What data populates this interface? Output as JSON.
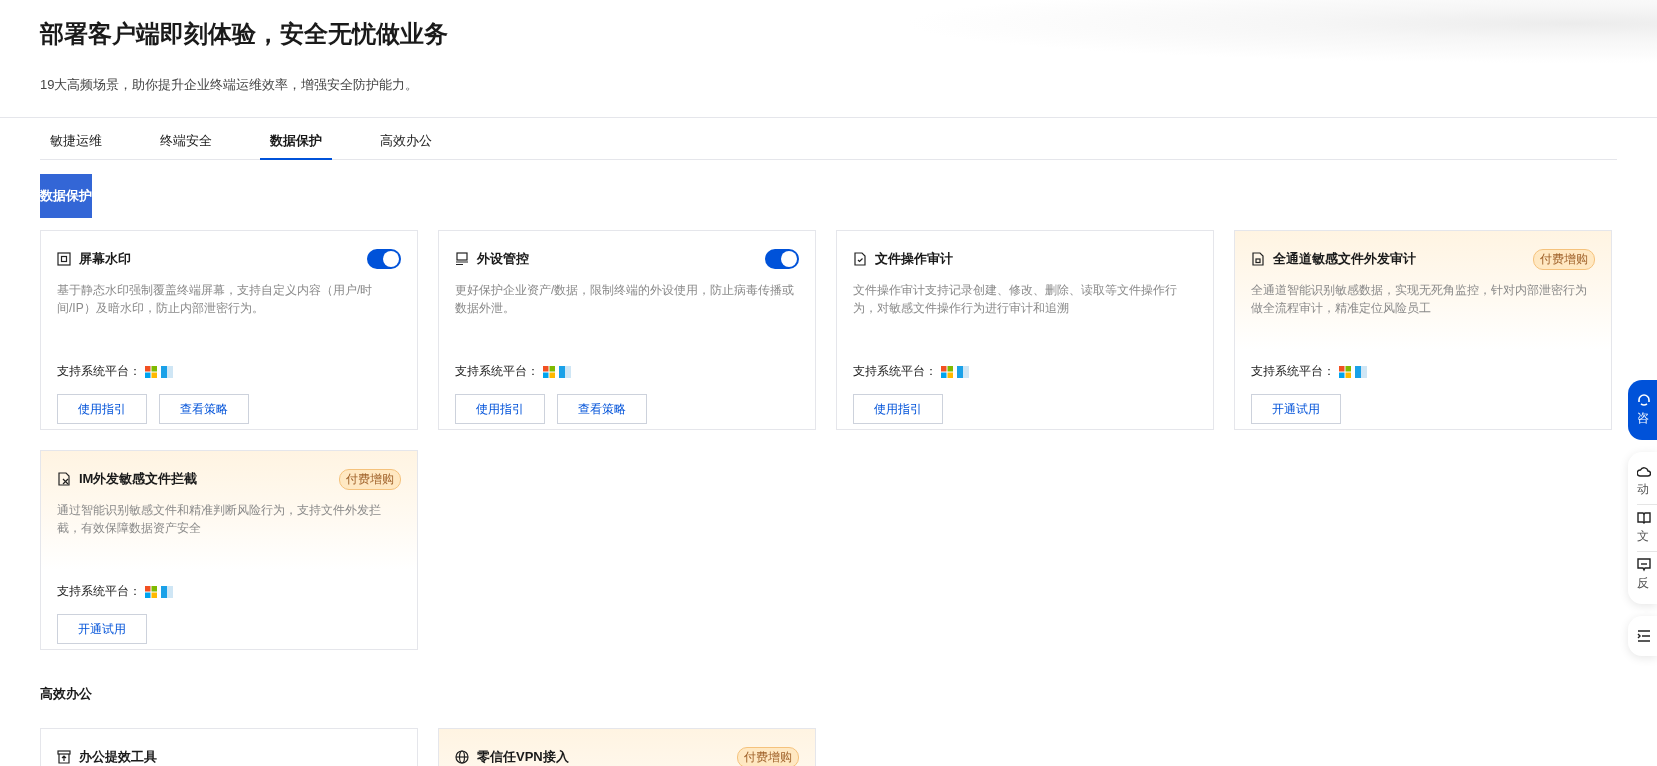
{
  "header": {
    "title": "部署客户端即刻体验，安全无忧做业务",
    "subtitle": "19大高频场景，助你提升企业终端运维效率，增强安全防护能力。"
  },
  "tabs": [
    {
      "label": "敏捷运维",
      "selected": false
    },
    {
      "label": "终端安全",
      "selected": false
    },
    {
      "label": "数据保护",
      "selected": true
    },
    {
      "label": "高效办公",
      "selected": false
    }
  ],
  "sections": [
    {
      "title": "数据保护",
      "kind": "badge",
      "cards": [
        {
          "kind": "toggle",
          "title": "屏幕水印",
          "on": true,
          "description": "基于静态水印强制覆盖终端屏幕，支持自定义内容（用户/时间/IP）及暗水印，防止内部泄密行为。",
          "platform_label": "支持系统平台：",
          "buttons": [
            "使用指引",
            "查看策略"
          ]
        },
        {
          "kind": "toggle",
          "title": "外设管控",
          "on": true,
          "description": "更好保护企业资产/数据，限制终端的外设使用，防止病毒传播或数据外泄。",
          "platform_label": "支持系统平台：",
          "buttons": [
            "使用指引",
            "查看策略"
          ]
        },
        {
          "kind": "plain",
          "title": "文件操作审计",
          "description": "文件操作审计支持记录创建、修改、删除、读取等文件操作行为，对敏感文件操作行为进行审计和追溯",
          "platform_label": "支持系统平台：",
          "buttons": [
            "使用指引"
          ]
        },
        {
          "kind": "paid",
          "title": "全通道敏感文件外发审计",
          "badge": "付费增购",
          "description": "全通道智能识别敏感数据，实现无死角监控，针对内部泄密行为做全流程审计，精准定位风险员工",
          "platform_label": "支持系统平台：",
          "buttons": [
            "开通试用"
          ]
        },
        {
          "kind": "paid",
          "title": "IM外发敏感文件拦截",
          "badge": "付费增购",
          "description": "通过智能识别敏感文件和精准判断风险行为，支持文件外发拦截，有效保障数据资产安全",
          "platform_label": "支持系统平台：",
          "buttons": [
            "开通试用"
          ]
        }
      ]
    },
    {
      "title": "高效办公",
      "kind": "plain",
      "cards": [
        {
          "kind": "plain",
          "title": "办公提效工具"
        },
        {
          "kind": "paid",
          "title": "零信任VPN接入",
          "badge": "付费增购"
        }
      ]
    }
  ],
  "side_panel": [
    {
      "kind": "primary",
      "label": "咨"
    },
    {
      "kind": "item",
      "label": "动"
    },
    {
      "kind": "item",
      "label": "文"
    },
    {
      "kind": "item",
      "label": "反"
    },
    {
      "kind": "icon"
    }
  ]
}
